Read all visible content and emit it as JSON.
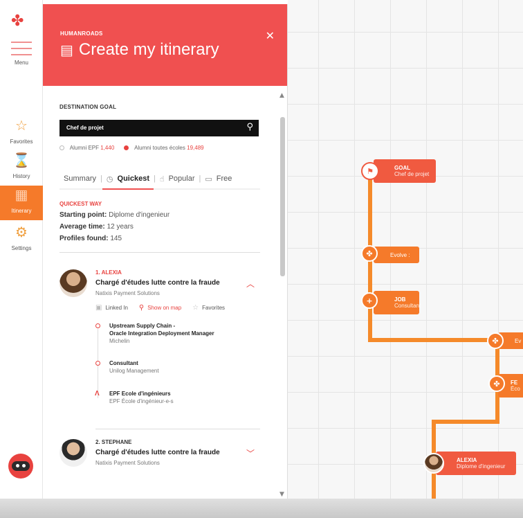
{
  "rail": {
    "menu_label": "Menu",
    "items": [
      {
        "label": "Favorites",
        "icon": "star-icon"
      },
      {
        "label": "History",
        "icon": "history-icon"
      },
      {
        "label": "Itinerary",
        "icon": "map-icon"
      },
      {
        "label": "Settings",
        "icon": "gear-icon"
      }
    ]
  },
  "panel": {
    "brand": "HUMANROADS",
    "title": "Create my itinerary",
    "destination_label": "DESTINATION GOAL",
    "search_value": "Chef de projet",
    "radio1_label": "Alumni EPF",
    "radio1_count": "1,440",
    "radio2_label": "Alumni toutes écoles",
    "radio2_count": "19,489",
    "tabs": [
      "Summary",
      "Quickest",
      "Popular",
      "Free"
    ],
    "quickest_title": "QUICKEST WAY",
    "starting_point_label": "Starting point:",
    "starting_point_value": "Diplome d'ingenieur",
    "average_time_label": "Average time:",
    "average_time_value": "12 years",
    "profiles_label": "Profiles found:",
    "profiles_value": "145"
  },
  "profiles": [
    {
      "name": "1. ALEXIA",
      "job": "Chargé d'études lutte contre la fraude",
      "company": "Natixis Payment Solutions",
      "linkedin": "Linked In",
      "show_on_map": "Show on map",
      "favorites": "Favorites",
      "timeline": [
        {
          "title": "Upstream Supply Chain -",
          "title2": "Oracle Integration Deployment Manager",
          "sub": "Michelin"
        },
        {
          "title": "Consultant",
          "sub": "Unilog Management"
        },
        {
          "title": "EPF Ecole d'ingénieurs",
          "sub": "EPF École d'ingénieur-e-s"
        }
      ]
    },
    {
      "name": "2. STEPHANE",
      "job": "Chargé d'études lutte contre la fraude",
      "company": "Natixis Payment Solutions"
    }
  ],
  "map": {
    "goal_title": "GOAL",
    "goal_sub": "Chef de projet",
    "evolve": "Evolve :",
    "job_title": "JOB",
    "job_sub": "Consultant",
    "edge1": "Ev",
    "edge2_a": "FE",
    "edge2_b": "Éco",
    "alexia_title": "ALEXIA",
    "alexia_sub": "Diplome d'ingenieur"
  },
  "colors": {
    "brand_red": "#f05050",
    "accent_orange": "#f57a2a"
  }
}
